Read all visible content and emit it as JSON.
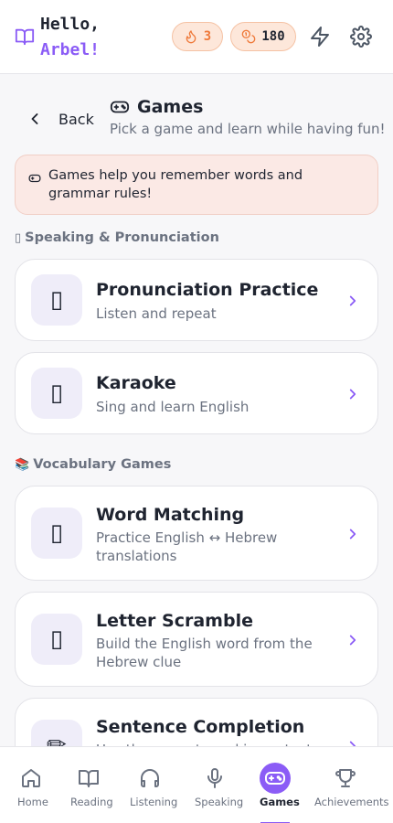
{
  "header": {
    "greeting": "Hello,",
    "user_name": "Arbel!",
    "streak": "3",
    "xp": "180",
    "accent": "#8b5cf6",
    "icons": [
      "book-icon",
      "fire-icon",
      "coins-icon",
      "bolt-icon",
      "gear-icon"
    ]
  },
  "nav": {
    "back_label": "Back"
  },
  "page": {
    "title": "Games",
    "subtitle": "Pick a game and learn while having fun!"
  },
  "banner": {
    "text": "Games help you remember words and grammar rules!"
  },
  "sections": [
    {
      "label": "Speaking & Pronunciation",
      "emoji": "▯",
      "games": [
        {
          "title": "Pronunciation Practice",
          "description": "Listen and repeat",
          "icon": "▯"
        },
        {
          "title": "Karaoke",
          "description": "Sing and learn English",
          "icon": "▯"
        }
      ]
    },
    {
      "label": "Vocabulary Games",
      "emoji": "📚",
      "games": [
        {
          "title": "Word Matching",
          "description": "Practice English ↔ Hebrew translations",
          "icon": "▯"
        },
        {
          "title": "Letter Scramble",
          "description": "Build the English word from the Hebrew clue",
          "icon": "▯"
        },
        {
          "title": "Sentence Completion",
          "description": "Use the correct word in context",
          "icon": "✏"
        }
      ]
    }
  ],
  "bottom_nav": {
    "active": "Games",
    "items": [
      {
        "label": "Home",
        "icon": "home-icon"
      },
      {
        "label": "Reading",
        "icon": "book-open-icon"
      },
      {
        "label": "Listening",
        "icon": "headphones-icon"
      },
      {
        "label": "Speaking",
        "icon": "microphone-icon"
      },
      {
        "label": "Games",
        "icon": "gamepad-icon"
      },
      {
        "label": "Achievements",
        "icon": "trophy-icon"
      }
    ]
  }
}
